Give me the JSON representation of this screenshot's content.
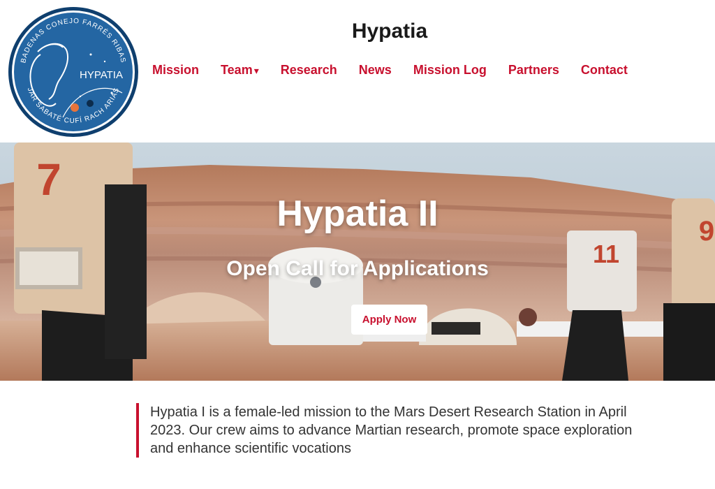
{
  "logo": {
    "text": "HYPATIA",
    "ring_top": "BADENAS CONEJO FARRÉS RIBAS",
    "ring_bottom": "JAR SABATÉ CUFÍ RACH ARIAS"
  },
  "header": {
    "title": "Hypatia"
  },
  "nav": {
    "items": [
      {
        "label": "Mission"
      },
      {
        "label": "Team",
        "has_dropdown": true,
        "caret": "▾"
      },
      {
        "label": "Research"
      },
      {
        "label": "News"
      },
      {
        "label": "Mission Log"
      },
      {
        "label": "Partners"
      },
      {
        "label": "Contact"
      }
    ]
  },
  "hero": {
    "title": "Hypatia II",
    "subtitle": "Open Call for Applications",
    "cta_label": "Apply Now",
    "backpack_numbers": [
      "7",
      "11",
      "9"
    ]
  },
  "intro": {
    "text": "Hypatia I is a female-led mission to the Mars Desert Research Station in April 2023. Our crew aims to advance Martian research, promote space exploration and enhance scientific vocations"
  },
  "colors": {
    "accent": "#c8102e",
    "logo_blue": "#1f5f9c"
  }
}
